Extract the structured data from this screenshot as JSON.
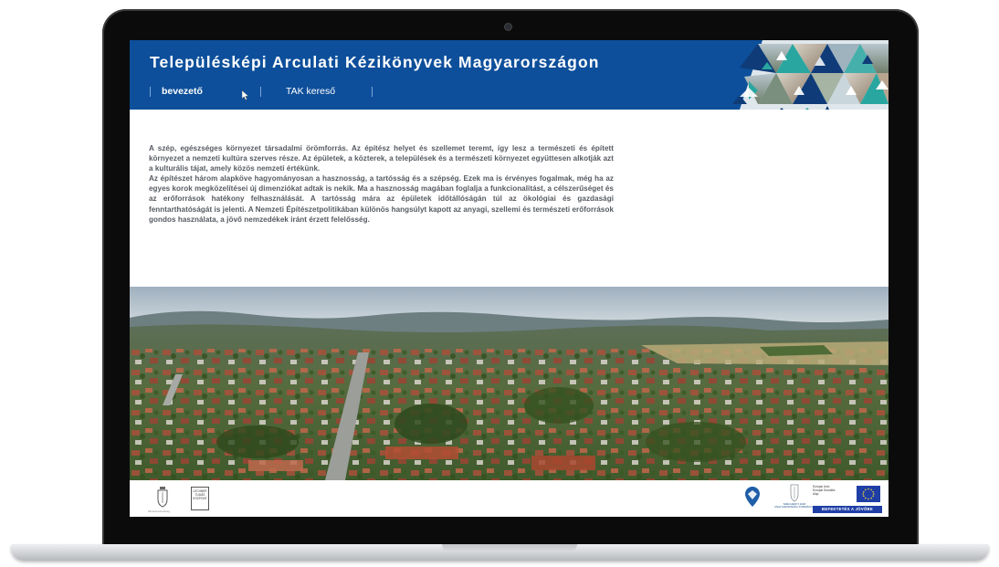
{
  "header": {
    "title": "Településképi Arculati Kézikönyvek Magyarországon",
    "nav": [
      {
        "label": "bevezető",
        "active": true
      },
      {
        "label": "TAK kereső",
        "active": false
      }
    ]
  },
  "intro": {
    "paragraphs": [
      "A szép, egészséges környezet társadalmi örömforrás. Az építész helyet és szellemet teremt, így lesz a természeti és épített környezet a nemzeti kultúra szerves része. Az épületek, a közterek, a települések és a természeti környezet együttesen alkotják azt a kulturális tájat, amely közös nemzeti értékünk.",
      "Az építészet három alapköve hagyományosan a hasznosság, a tartósság és a szépség. Ezek ma is érvényes fogalmak, még ha az egyes korok megközelítései új dimenziókat adtak is nekik. Ma a hasznosság magában foglalja a funkcionalitást, a célszerűséget és az erőforrások hatékony felhasználását. A tartósság mára az épületek időtállóságán túl az ökológiai és gazdasági fenntarthatóságát is jelenti. A Nemzeti Építészetpolitikában különös hangsúlyt kapott az anyagi, szellemi és természeti erőforrások gondos használata, a jövő nemzedékek iránt érzett felelősség."
    ]
  },
  "footer": {
    "crest_caption": "Miniszterelnökség",
    "box_logo_lines": [
      "LECHNER",
      "TUDÁS",
      "KÖZPONT"
    ],
    "gov_caption": [
      "SZÉCHENYI 2020",
      "MAGYARORSZÁG KORMÁNYA"
    ],
    "eu_text": [
      "Európai Unió",
      "Európai Szociális",
      "Alap"
    ],
    "eu_bar": "BEFEKTETÉS A JÖVŐBE"
  },
  "colors": {
    "header_bg": "#0d4f9b",
    "teal": "#2aa6a0",
    "navy": "#0f3c78",
    "eu_blue": "#1f3fa6"
  }
}
